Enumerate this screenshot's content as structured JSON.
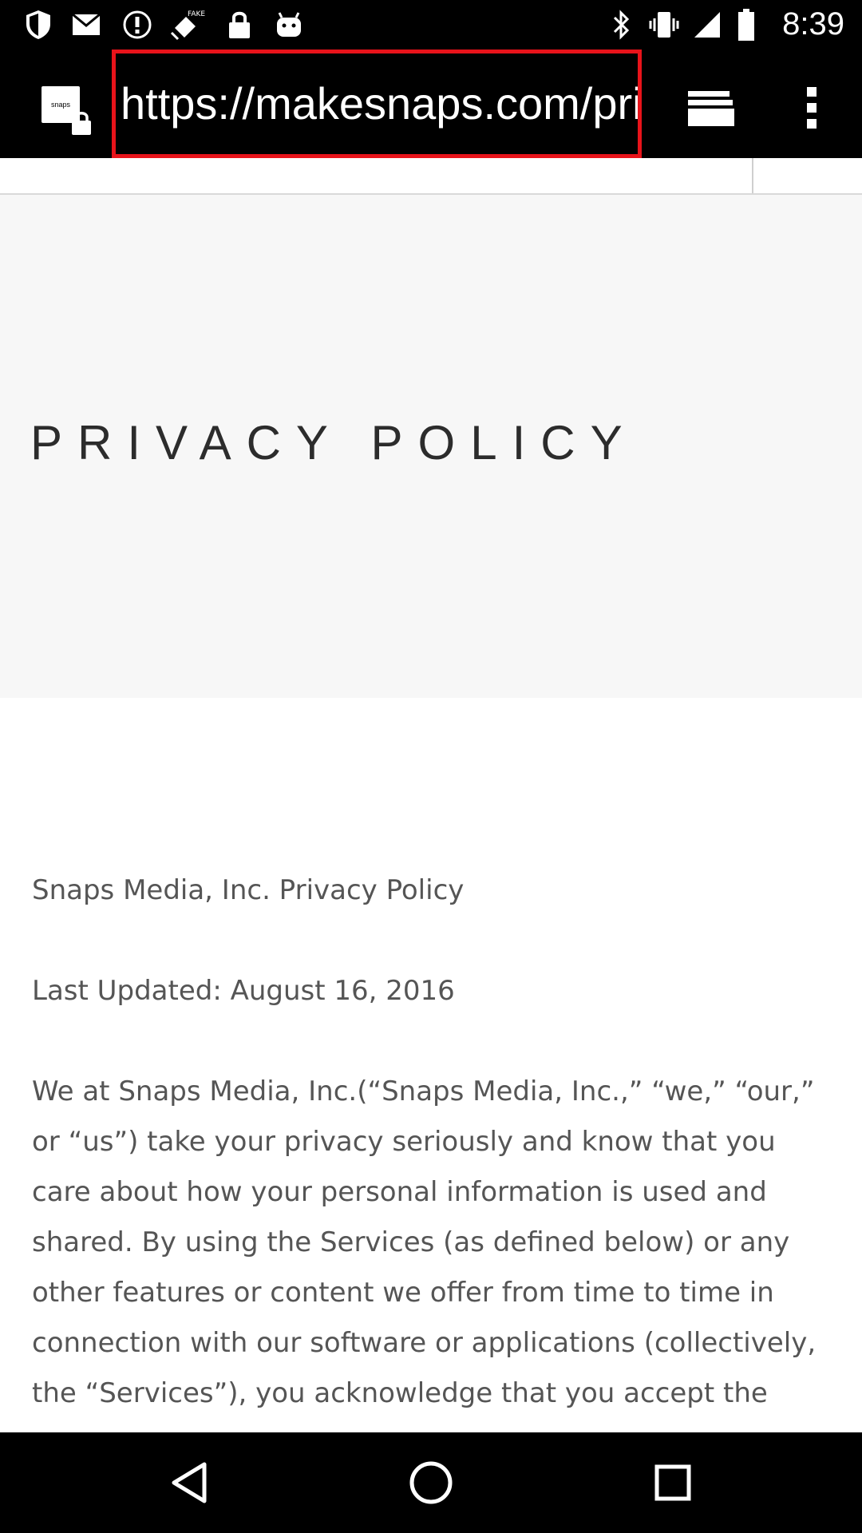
{
  "status_bar": {
    "time": "8:39",
    "icons": [
      "shield-icon",
      "gmail-icon",
      "alert-icon",
      "fake-gps-icon",
      "lock-icon",
      "android-icon",
      "bluetooth-icon",
      "vibrate-icon",
      "signal-icon",
      "battery-icon"
    ]
  },
  "toolbar": {
    "favicon_text": "snaps",
    "url": "https://makesnaps.com/privacy",
    "tabs_icon": "tabs-icon",
    "menu_icon": "overflow-menu-icon"
  },
  "page": {
    "hero_title": "PRIVACY POLICY",
    "heading": "Snaps Media, Inc. Privacy Policy",
    "last_updated": "Last Updated: August 16, 2016",
    "body": "We at Snaps Media, Inc.(“Snaps Media, Inc.,” “we,” “our,” or “us”) take your privacy seriously and know that you care about how your personal information is used and shared. By using the Services (as defined below) or any other features or content we offer from time to time in connection with our software or applications (collectively, the “Services”), you acknowledge that you accept the"
  },
  "nav_bar": {
    "back": "back-icon",
    "home": "home-icon",
    "recents": "recents-icon"
  }
}
